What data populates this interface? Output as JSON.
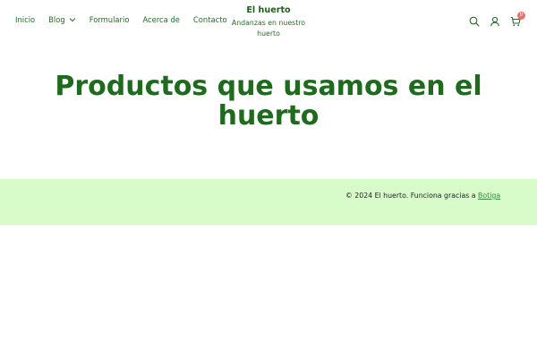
{
  "nav": {
    "items": [
      "Inicio",
      "Blog",
      "Formulario",
      "Acerca de",
      "Contacto"
    ]
  },
  "brand": {
    "title": "El huerto",
    "tagline": "Andanzas en nuestro huerto"
  },
  "header_icons": [
    "search-icon",
    "user-icon",
    "cart-icon"
  ],
  "cart": {
    "count": "0"
  },
  "page": {
    "title": "Productos que usamos en el huerto"
  },
  "footer": {
    "text": "© 2024 El huerto. Funciona gracias a ",
    "link": "Botiga"
  },
  "colors": {
    "primary": "#1e6b1e",
    "footer_bg": "#d7fbc9",
    "badge": "#e57373"
  }
}
